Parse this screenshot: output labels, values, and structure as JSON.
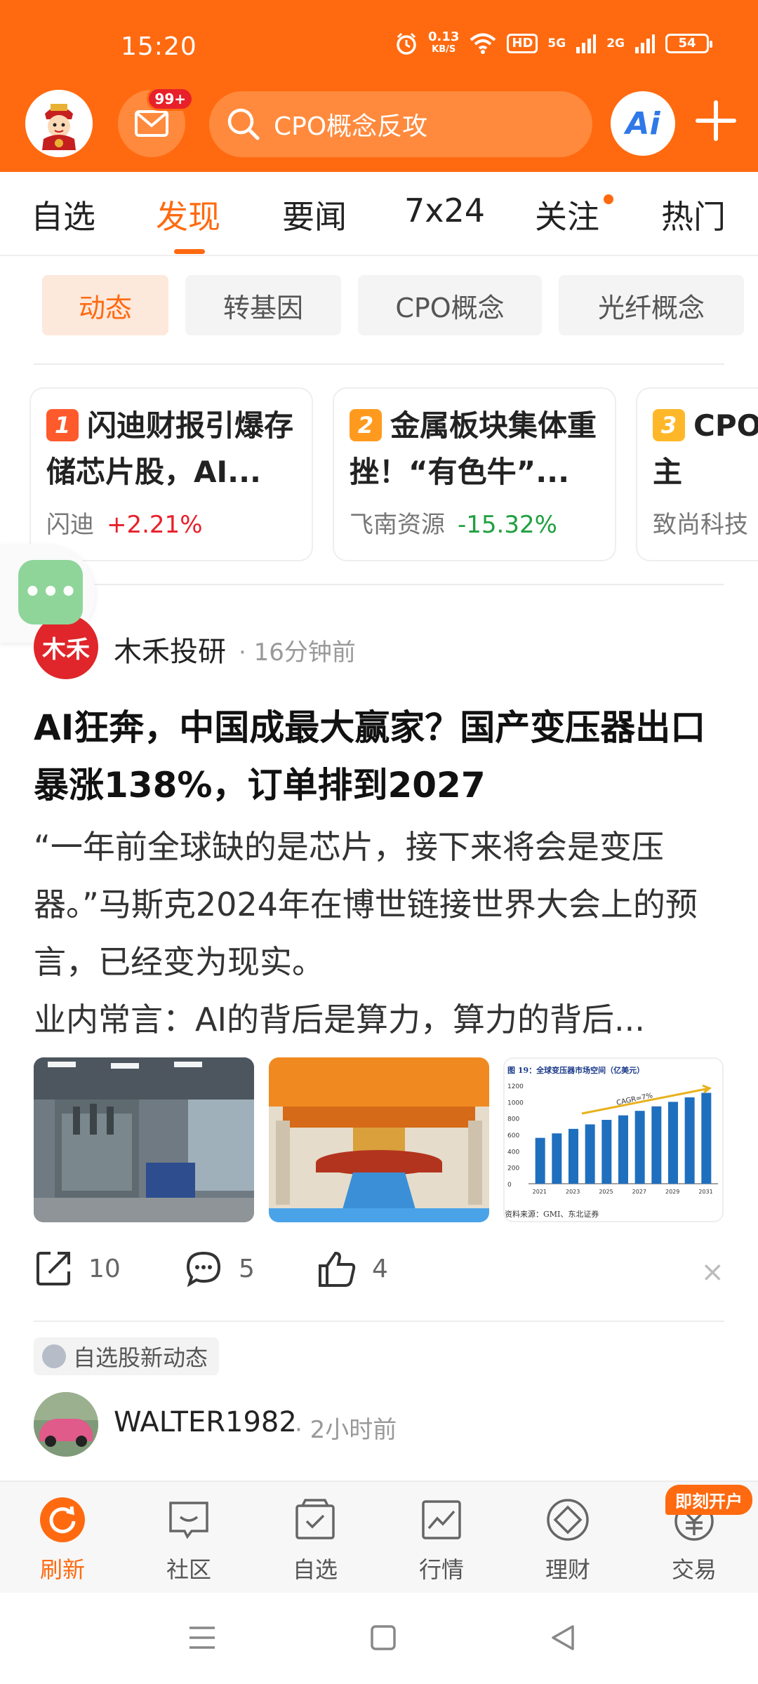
{
  "status_bar": {
    "time": "15:20",
    "speed_value": "0.13",
    "speed_unit": "KB/S",
    "hd": "HD",
    "net1": "5G",
    "net2": "2G",
    "battery": "54"
  },
  "header": {
    "mail_badge": "99+",
    "search_text": "CPO概念反攻",
    "ai_label": "Ai"
  },
  "tabs": [
    "自选",
    "发现",
    "要闻",
    "7x24",
    "关注",
    "热门"
  ],
  "active_tab": "发现",
  "chips": [
    "动态",
    "转基因",
    "CPO概念",
    "光纤概念"
  ],
  "active_chip": "动态",
  "hot_cards": [
    {
      "rank": "1",
      "title": "闪迪财报引爆存储芯片股，AI...",
      "stock": "闪迪",
      "change": "+2.21%",
      "direction": "up"
    },
    {
      "rank": "2",
      "title": "金属板块集体重挫！“有色牛”...",
      "stock": "飞南资源",
      "change": "-15.32%",
      "direction": "down"
    },
    {
      "rank": "3",
      "title": "CPO概念反攻：主",
      "stock": "致尚科技",
      "change": "",
      "direction": "up"
    }
  ],
  "rank_colors": {
    "1": "#ff5a2c",
    "2": "#ff9a1f",
    "3": "#ffb72a"
  },
  "floating_button": "•••",
  "article": {
    "author_logo": "木禾",
    "author": "木禾投研",
    "time": "· 16分钟前",
    "title": "AI狂奔，中国成最大赢家？国产变压器出口暴涨138%，订单排到2027",
    "summary": "“一年前全球缺的是芯片，接下来将会是变压器。”马斯克2024年在博世链接世界大会上的预言，已经变为现实。",
    "summary_line4": "业内常言：AI的背后是算力，算力的背后...",
    "share_count": "10",
    "comment_count": "5",
    "like_count": "4",
    "close": "×"
  },
  "thumb_chart": {
    "title": "图 19：全球变压器市场空间（亿美元）",
    "annotation": "CAGR=7%",
    "source": "资料来源：GMI、东北证券",
    "y_ticks": [
      "1200",
      "1000",
      "800",
      "600",
      "400",
      "200",
      "0"
    ],
    "x_ticks": [
      "2021",
      "2023",
      "2025",
      "2027",
      "2029",
      "2031"
    ]
  },
  "tag": {
    "label": "自选股新动态"
  },
  "next_post": {
    "user": "WALTER1982",
    "time": "· 2小时前"
  },
  "bottom_nav": {
    "items": [
      "刷新",
      "社区",
      "自选",
      "行情",
      "理财",
      "交易"
    ],
    "active": "刷新",
    "promo": "即刻开户"
  },
  "colors": {
    "brand": "#ff6a10",
    "up": "#e8202a",
    "down": "#20a040"
  }
}
